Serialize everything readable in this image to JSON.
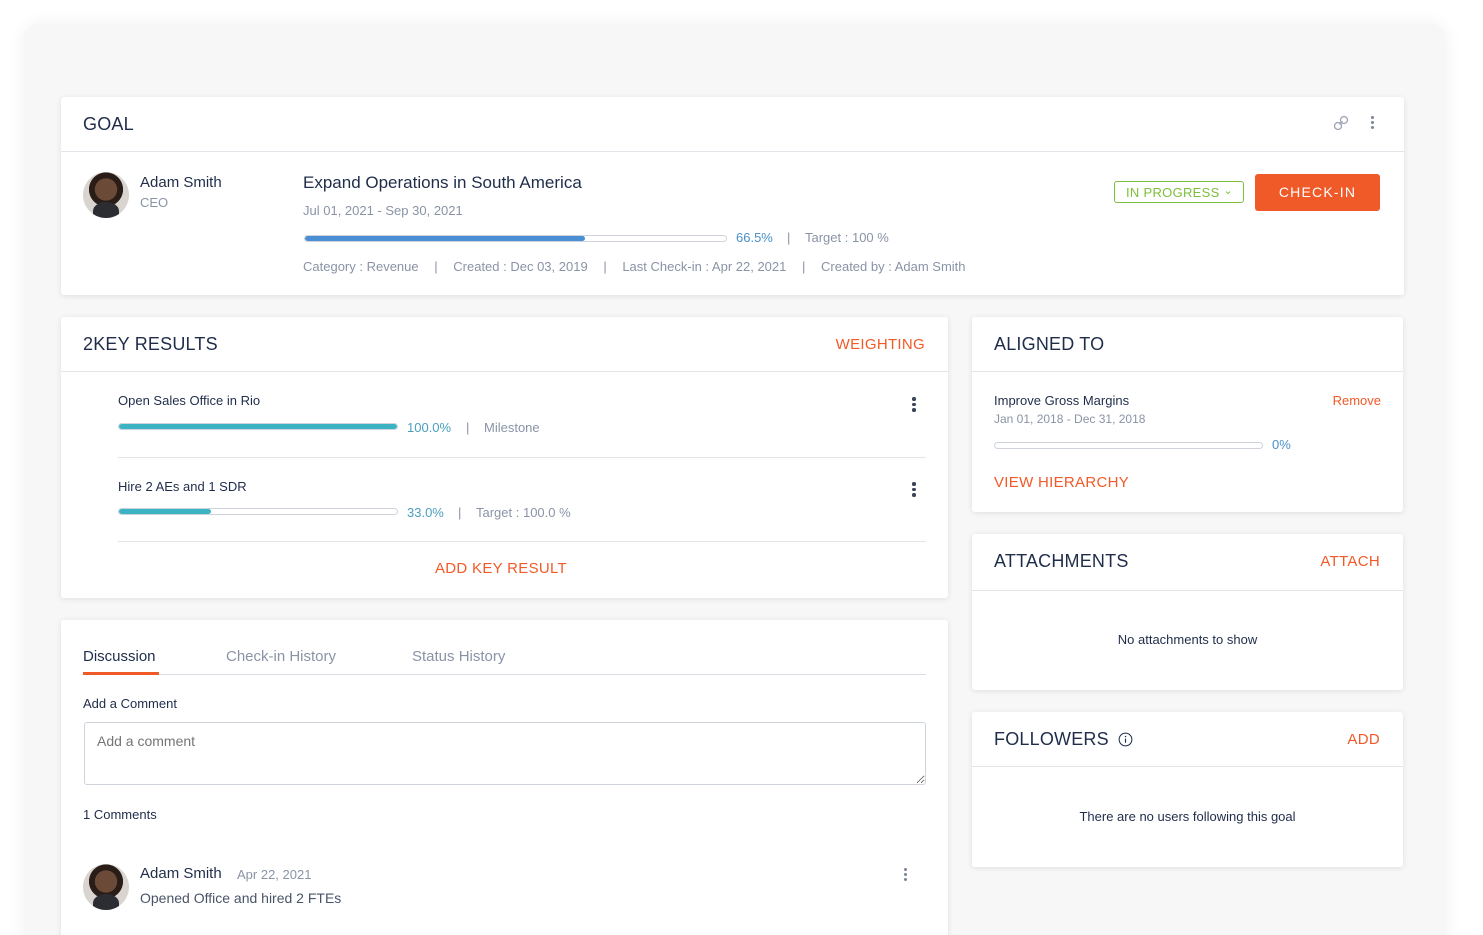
{
  "goal": {
    "header": "GOAL",
    "owner": {
      "name": "Adam Smith",
      "role": "CEO"
    },
    "title": "Expand Operations in South America",
    "dates": "Jul 01, 2021 - Sep 30, 2021",
    "progress": {
      "value": 0.665,
      "percent_label": "66.5%",
      "target_label": "Target : 100 %"
    },
    "meta": {
      "category": "Category : Revenue",
      "created": "Created : Dec 03, 2019",
      "last_checkin": "Last Check-in : Apr 22, 2021",
      "created_by": "Created by : Adam Smith"
    },
    "status": "IN PROGRESS",
    "checkin_label": "CHECK-IN",
    "separator": "|"
  },
  "key_results": {
    "header": "2KEY RESULTS",
    "weighting_label": "WEIGHTING",
    "items": [
      {
        "title": "Open Sales Office in Rio",
        "progress": 1.0,
        "percent_label": "100.0%",
        "extra": "Milestone"
      },
      {
        "title": "Hire 2 AEs and 1 SDR",
        "progress": 0.33,
        "percent_label": "33.0%",
        "extra": "Target : 100.0 %"
      }
    ],
    "add_label": "ADD KEY RESULT"
  },
  "aligned": {
    "header": "ALIGNED TO",
    "item": {
      "title": "Improve Gross Margins",
      "dates": "Jan 01, 2018 - Dec 31, 2018",
      "progress": 0,
      "percent_label": "0%",
      "remove_label": "Remove"
    },
    "view_label": "VIEW HIERARCHY"
  },
  "attachments": {
    "header": "ATTACHMENTS",
    "action_label": "ATTACH",
    "empty_text": "No attachments to show"
  },
  "followers": {
    "header": "FOLLOWERS",
    "info_icon": "info-icon",
    "action_label": "ADD",
    "empty_text": "There are no users following this goal"
  },
  "discussion": {
    "tabs": [
      "Discussion",
      "Check-in History",
      "Status History"
    ],
    "add_comment_label": "Add a Comment",
    "comment_placeholder": "Add a comment",
    "comments_count": "1 Comments",
    "comments": [
      {
        "author": "Adam Smith",
        "date": "Apr 22, 2021",
        "text": "Opened Office and hired 2 FTEs"
      }
    ]
  },
  "colors": {
    "accent": "#f05a28",
    "status_green": "#7dbf3a",
    "progress_blue": "#4a8fd4",
    "progress_teal": "#3bb3c3"
  }
}
